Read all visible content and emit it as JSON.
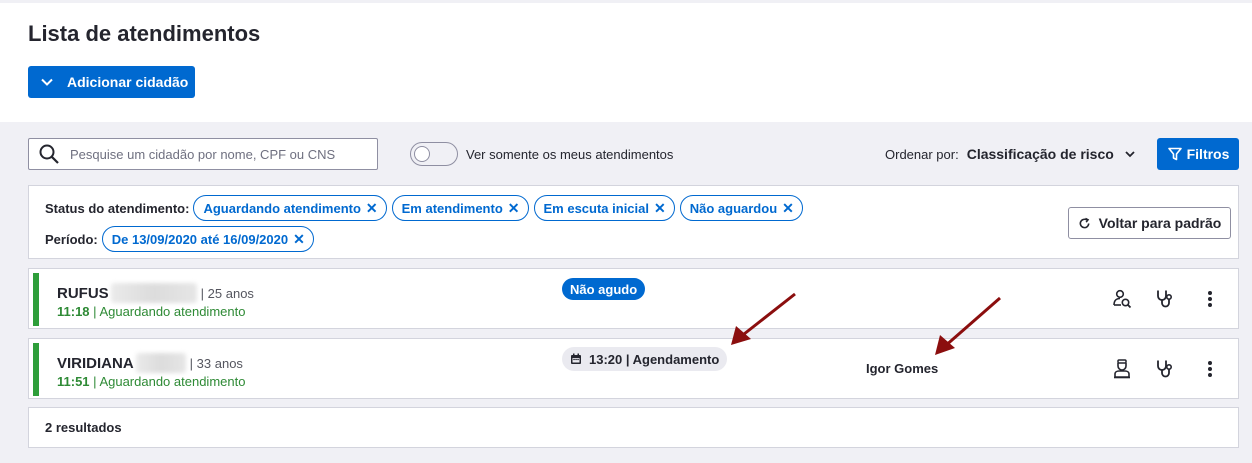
{
  "page": {
    "title": "Lista de atendimentos",
    "add_button_label": "Adicionar cidadão"
  },
  "toolbar": {
    "search_placeholder": "Pesquise um cidadão por nome, CPF ou CNS",
    "toggle_label": "Ver somente os meus atendimentos",
    "sort_label": "Ordenar por:",
    "sort_value": "Classificação de risco",
    "filter_button_label": "Filtros"
  },
  "filters": {
    "status_label": "Status do atendimento:",
    "status_chips": [
      "Aguardando atendimento",
      "Em atendimento",
      "Em escuta inicial",
      "Não aguardou"
    ],
    "period_label": "Período:",
    "period_chip": "De 13/09/2020 até 16/09/2020",
    "reset_label": "Voltar para padrão"
  },
  "rows": [
    {
      "name": "RUFUS",
      "age": "| 25 anos",
      "time": "11:18",
      "status": "| Aguardando atendimento",
      "badge": "Não agudo",
      "professional": ""
    },
    {
      "name": "VIRIDIANA",
      "age": "| 33 anos",
      "time": "11:51",
      "status": "| Aguardando atendimento",
      "badge": "13:20 | Agendamento",
      "professional": "Igor Gomes"
    }
  ],
  "results_text": "2 resultados",
  "colors": {
    "primary": "#0069d0",
    "status_green": "#2e9e3a",
    "background": "#f0f0f5",
    "annotation_arrow": "#8b0e0e"
  }
}
